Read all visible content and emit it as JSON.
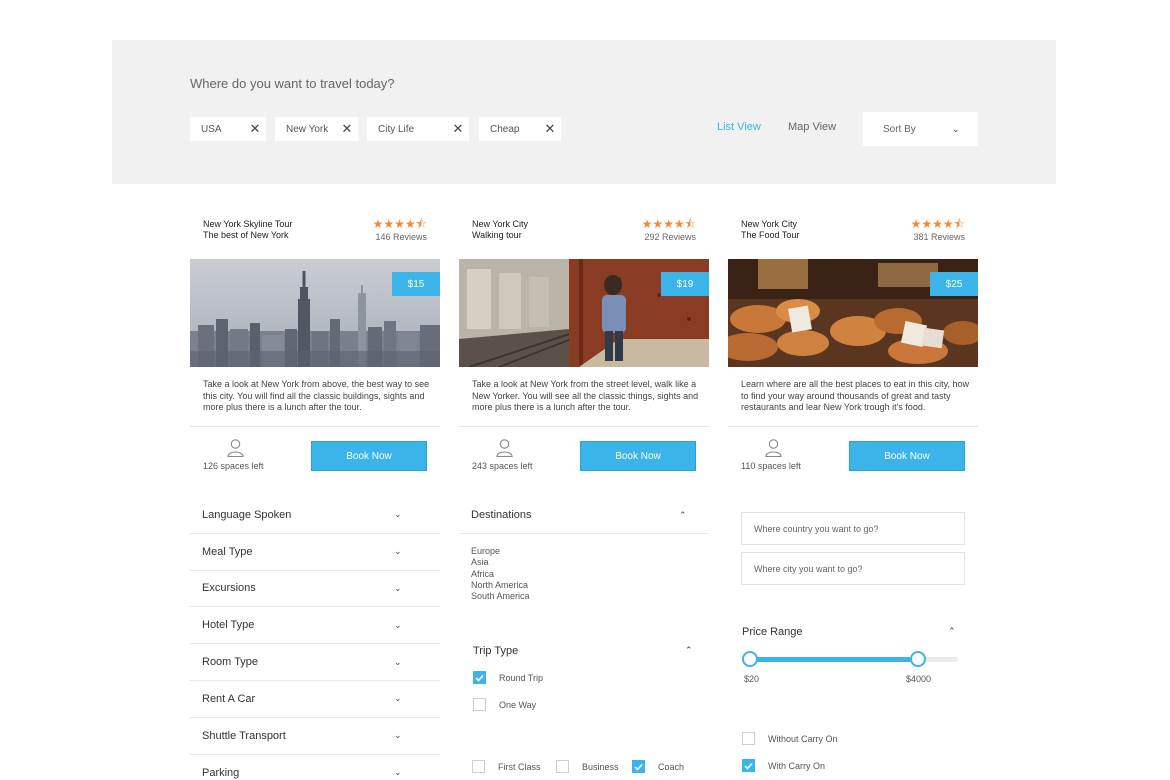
{
  "search": {
    "question": "Where do you want to travel today?",
    "chips": [
      {
        "label": "USA"
      },
      {
        "label": "New York"
      },
      {
        "label": "City Life"
      },
      {
        "label": "Cheap"
      }
    ],
    "chip_remove_glyph": "✕",
    "list_view_label": "List View",
    "map_view_label": "Map View",
    "sort_label": "Sort By"
  },
  "tours": [
    {
      "title_line1": "New York Skyline Tour",
      "title_line2": "The best of New York",
      "stars": "★★★★⯪",
      "reviews": "146 Reviews",
      "price": "$15",
      "description": "Take a look at New York from above, the best way to see this city. You will find all the classic buildings, sights and more plus there is a lunch after the tour.",
      "spaces_left": "126 spaces left",
      "book_label": "Book Now"
    },
    {
      "title_line1": "New York City",
      "title_line2": "Walking tour",
      "stars": "★★★★⯪",
      "reviews": "292 Reviews",
      "price": "$19",
      "description": "Take a look at New York from the street level, walk like a New Yorker. You will see all the classic things, sights and more plus there is a lunch after the tour.",
      "spaces_left": "243 spaces left",
      "book_label": "Book Now"
    },
    {
      "title_line1": "New York City",
      "title_line2": "The Food Tour",
      "stars": "★★★★⯪",
      "reviews": "381 Reviews",
      "price": "$25",
      "description": "Learn where are all the best places to eat in this city, how to find your way around thousands of great and tasty restaurants and lear New York trough it's food.",
      "spaces_left": "110 spaces left",
      "book_label": "Book Now"
    }
  ],
  "filters": [
    "Language Spoken",
    "Meal Type",
    "Excursions",
    "Hotel Type",
    "Room Type",
    "Rent A Car",
    "Shuttle Transport",
    "Parking"
  ],
  "destinations": {
    "title": "Destinations",
    "items": [
      "Europe",
      "Asia",
      "Africa",
      "North America",
      "South America"
    ]
  },
  "trip_type": {
    "title": "Trip Type",
    "options": [
      {
        "label": "Round Trip",
        "checked": true
      },
      {
        "label": "One Way",
        "checked": false
      }
    ],
    "classes": [
      {
        "label": "First Class",
        "checked": false
      },
      {
        "label": "Business",
        "checked": false
      },
      {
        "label": "Coach",
        "checked": true
      }
    ]
  },
  "location": {
    "country_placeholder": "Where country you want to go?",
    "city_placeholder": "Where city you want to go?"
  },
  "price_range": {
    "title": "Price Range",
    "min_label": "$20",
    "max_label": "$4000",
    "low_fraction": 0.0,
    "high_fraction": 0.81
  },
  "baggage": [
    {
      "label": "Without Carry On",
      "checked": false
    },
    {
      "label": "With Carry On",
      "checked": true
    }
  ],
  "glyphs": {
    "caret_down": "⌄",
    "caret_up": "⌃"
  },
  "colors": {
    "accent": "#3bb4ea",
    "star": "#f08a37",
    "panel": "#f1f1f1"
  }
}
